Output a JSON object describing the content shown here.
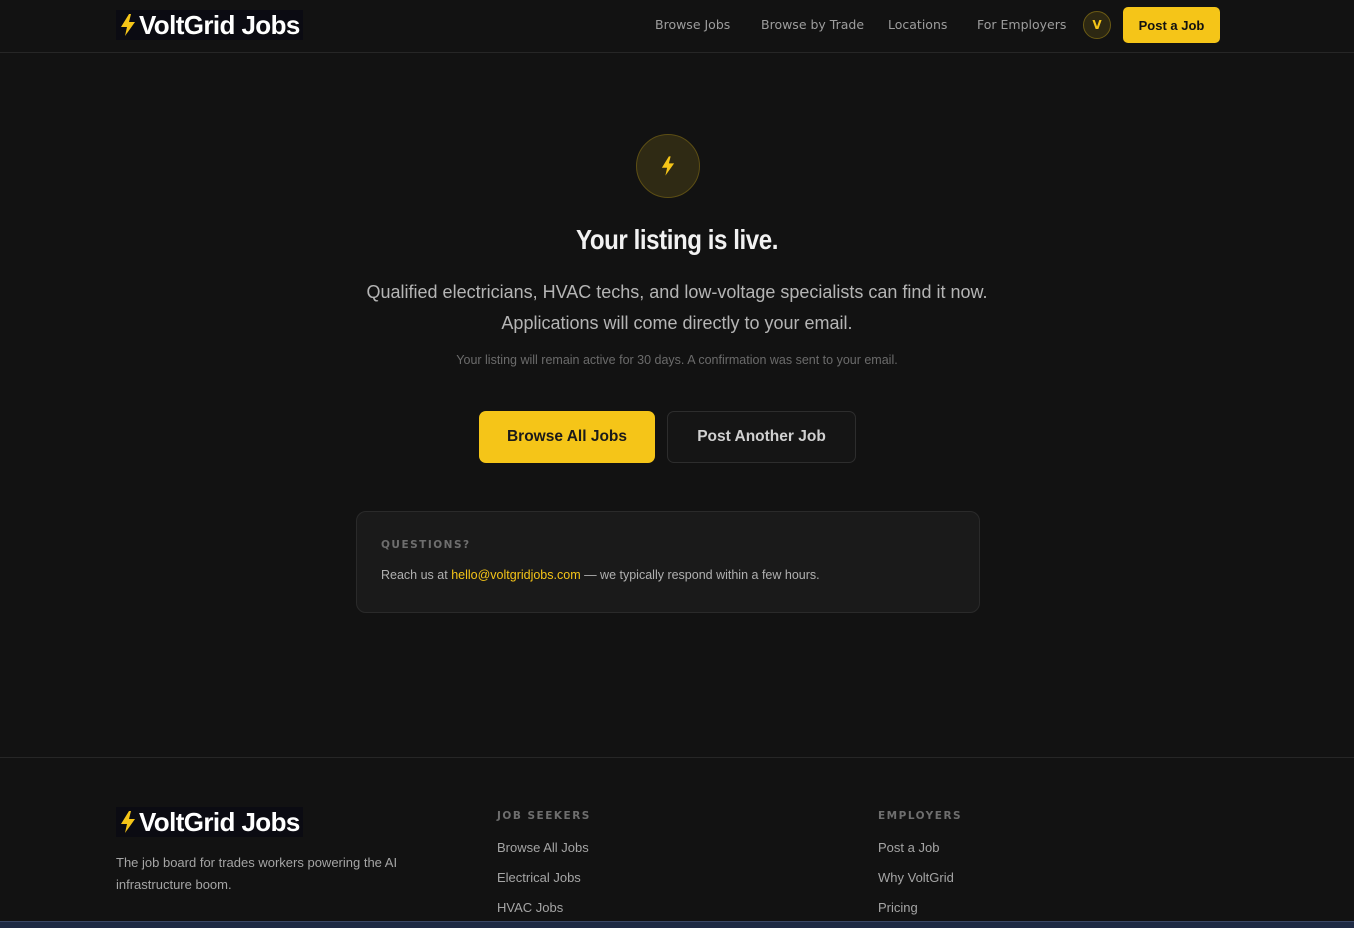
{
  "brand": {
    "name": "VoltGrid Jobs",
    "accent": "#f5c518",
    "icon": "lightning-bolt-icon"
  },
  "nav": {
    "links": [
      "Browse Jobs",
      "Browse by Trade",
      "Locations",
      "For Employers"
    ],
    "avatar_initial": "V",
    "post_job": "Post a Job"
  },
  "hero": {
    "icon": "lightning-bolt-icon",
    "title": "Your listing is live.",
    "subtitle": "Qualified electricians, HVAC techs, and low-voltage specialists can find it now. Applications will come directly to your email.",
    "note": "Your listing will remain active for 30 days. A confirmation was sent to your email.",
    "primary_button": "Browse All Jobs",
    "secondary_button": "Post Another Job"
  },
  "questions": {
    "label": "QUESTIONS?",
    "prefix": "Reach us at ",
    "email": "hello@voltgridjobs.com",
    "suffix": " — we typically respond within a few hours."
  },
  "footer": {
    "tagline": "The job board for trades workers powering the AI infrastructure boom.",
    "job_seekers": {
      "heading": "JOB SEEKERS",
      "links": [
        "Browse All Jobs",
        "Electrical Jobs",
        "HVAC Jobs"
      ]
    },
    "employers": {
      "heading": "EMPLOYERS",
      "links": [
        "Post a Job",
        "Why VoltGrid",
        "Pricing"
      ]
    }
  }
}
